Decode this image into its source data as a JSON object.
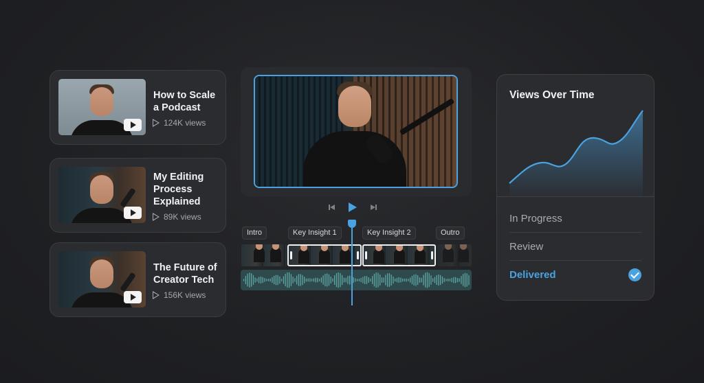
{
  "videos": [
    {
      "title_line1": "How to Scale",
      "title_line2": "a Podcast",
      "title_line3": "",
      "views": "124K views"
    },
    {
      "title_line1": "My Editing",
      "title_line2": "Process",
      "title_line3": "Explained",
      "views": "89K views"
    },
    {
      "title_line1": "The Future of",
      "title_line2": "Creator Tech",
      "title_line3": "",
      "views": "156K views"
    }
  ],
  "timeline": {
    "chapters": [
      "Intro",
      "Key Insight 1",
      "Key Insight 2",
      "Outro"
    ]
  },
  "panel": {
    "title": "Views Over Time",
    "statuses": [
      {
        "label": "In Progress",
        "active": false
      },
      {
        "label": "Review",
        "active": false
      },
      {
        "label": "Delivered",
        "active": true
      }
    ]
  },
  "colors": {
    "accent": "#4aa3e0",
    "card_bg": "#2b2c30",
    "page_bg": "#1f2023"
  },
  "icons": [
    "play-icon",
    "prev-icon",
    "next-icon",
    "check-icon",
    "play-badge-icon"
  ]
}
